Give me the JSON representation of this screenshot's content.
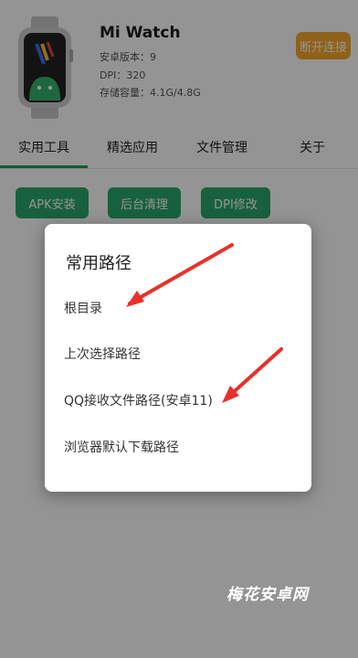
{
  "device": {
    "name": "Mi Watch",
    "android_version": "安卓版本：9",
    "dpi": "DPI：320",
    "storage": "存储容量：4.1G/4.8G",
    "disconnect_label": "断开连接"
  },
  "tabs": [
    {
      "label": "实用工具",
      "selected": true
    },
    {
      "label": "精选应用",
      "selected": false
    },
    {
      "label": "文件管理",
      "selected": false
    },
    {
      "label": "关于",
      "selected": false
    }
  ],
  "tools": [
    {
      "label": "APK安装"
    },
    {
      "label": "后台清理"
    },
    {
      "label": "DPI修改"
    }
  ],
  "dialog": {
    "title": "常用路径",
    "options": [
      {
        "label": "根目录"
      },
      {
        "label": "上次选择路径"
      },
      {
        "label": "QQ接收文件路径(安卓11)"
      },
      {
        "label": "浏览器默认下载路径"
      }
    ]
  },
  "watermark": "梅花安卓网",
  "colors": {
    "accent": "#2aa86c",
    "disconnect": "#f6a72c",
    "annotation_arrow": "#e8312a"
  }
}
